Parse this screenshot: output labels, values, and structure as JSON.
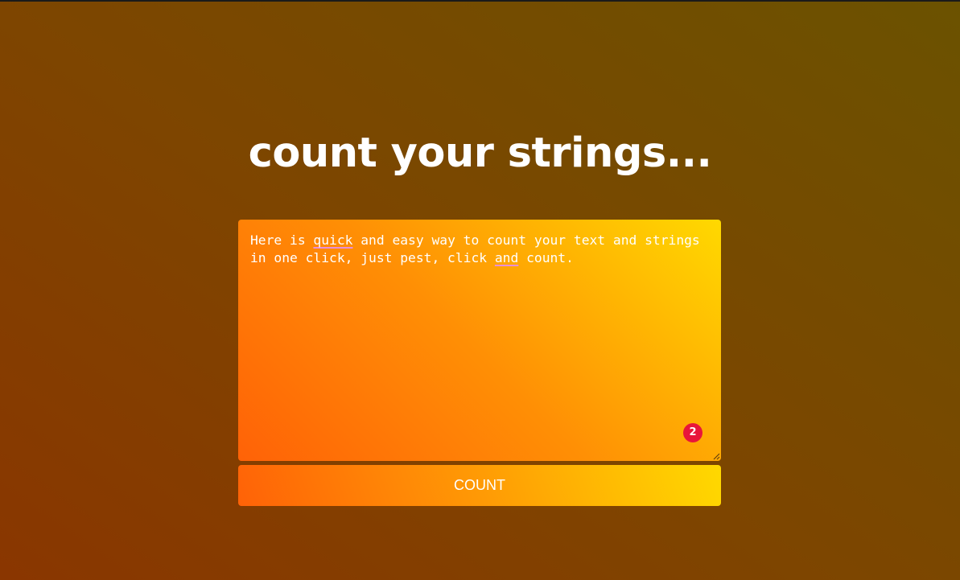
{
  "page": {
    "title": "count your strings..."
  },
  "editor": {
    "text_parts": [
      "Here is ",
      "quick",
      " and easy way to count your text and strings\nin one click, just pest, click ",
      "and",
      " count."
    ],
    "badge_count": "2"
  },
  "button": {
    "label": "COUNT"
  },
  "colors": {
    "background_start": "#8a3600",
    "background_end": "#6b5200",
    "accent_orange": "#ff6207",
    "accent_yellow": "#ffd900",
    "badge": "#e8153b",
    "text": "#ffffff"
  },
  "icons": {
    "resize_handle": "resize-handle-icon"
  }
}
